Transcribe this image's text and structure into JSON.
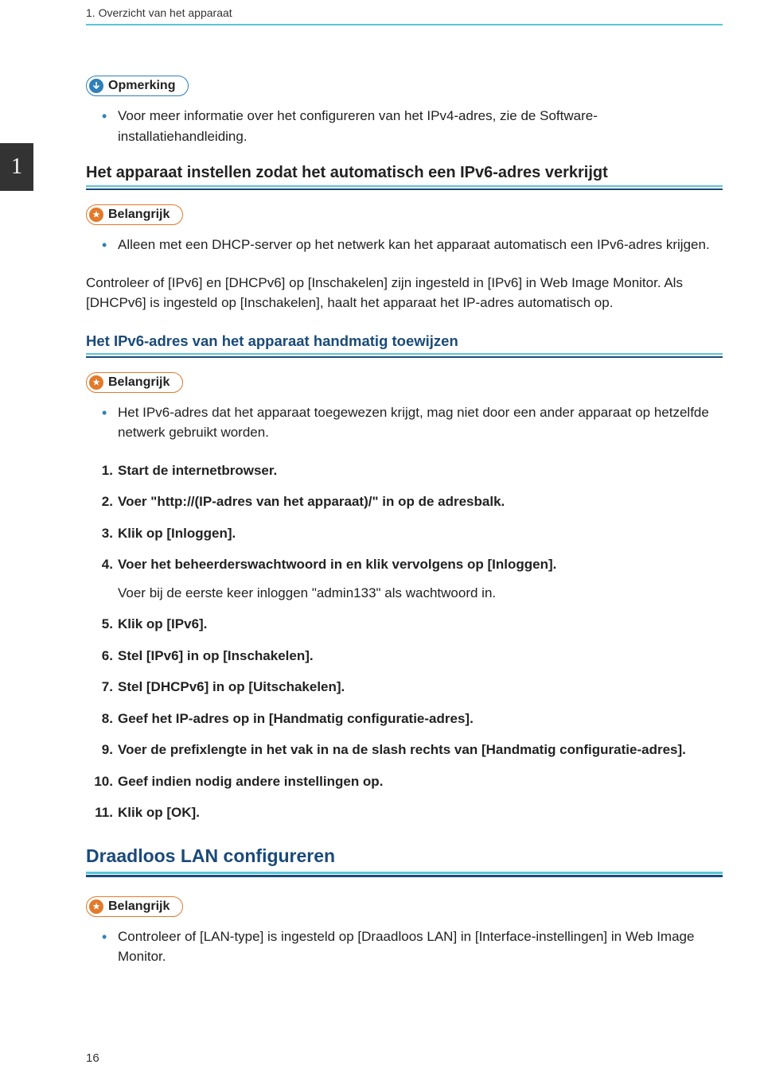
{
  "header": {
    "breadcrumb": "1. Overzicht van het apparaat",
    "chapter_number": "1"
  },
  "callout_labels": {
    "note": "Opmerking",
    "important": "Belangrijk"
  },
  "section_note": {
    "bullets": [
      "Voor meer informatie over het configureren van het IPv4-adres, zie de Software-installatiehandleiding."
    ]
  },
  "section_auto": {
    "title": "Het apparaat instellen zodat het automatisch een IPv6-adres verkrijgt",
    "bullets": [
      "Alleen met een DHCP-server op het netwerk kan het apparaat automatisch een IPv6-adres krijgen."
    ],
    "paragraph": "Controleer of [IPv6] en [DHCPv6] op [Inschakelen] zijn ingesteld in [IPv6] in Web Image Monitor. Als [DHCPv6] is ingesteld op [Inschakelen], haalt het apparaat het IP-adres automatisch op."
  },
  "section_manual": {
    "title": "Het IPv6-adres van het apparaat handmatig toewijzen",
    "bullets": [
      "Het IPv6-adres dat het apparaat toegewezen krijgt, mag niet door een ander apparaat op hetzelfde netwerk gebruikt worden."
    ],
    "steps": [
      {
        "text": "Start de internetbrowser."
      },
      {
        "text": "Voer \"http://(IP-adres van het apparaat)/\" in op de adresbalk."
      },
      {
        "text": "Klik op [Inloggen]."
      },
      {
        "text": "Voer het beheerderswachtwoord in en klik vervolgens op [Inloggen].",
        "sub": "Voer bij de eerste keer inloggen \"admin133\" als wachtwoord in."
      },
      {
        "text": "Klik op [IPv6]."
      },
      {
        "text": "Stel [IPv6] in op [Inschakelen]."
      },
      {
        "text": "Stel [DHCPv6] in op [Uitschakelen]."
      },
      {
        "text": "Geef het IP-adres op in [Handmatig configuratie-adres]."
      },
      {
        "text": "Voer de prefixlengte in het vak in na de slash rechts van [Handmatig configuratie-adres]."
      },
      {
        "text": "Geef indien nodig andere instellingen op."
      },
      {
        "text": "Klik op [OK]."
      }
    ]
  },
  "section_wlan": {
    "title": "Draadloos LAN configureren",
    "bullets": [
      "Controleer of [LAN-type] is ingesteld op [Draadloos LAN] in [Interface-instellingen] in Web Image Monitor."
    ]
  },
  "page_number": "16"
}
